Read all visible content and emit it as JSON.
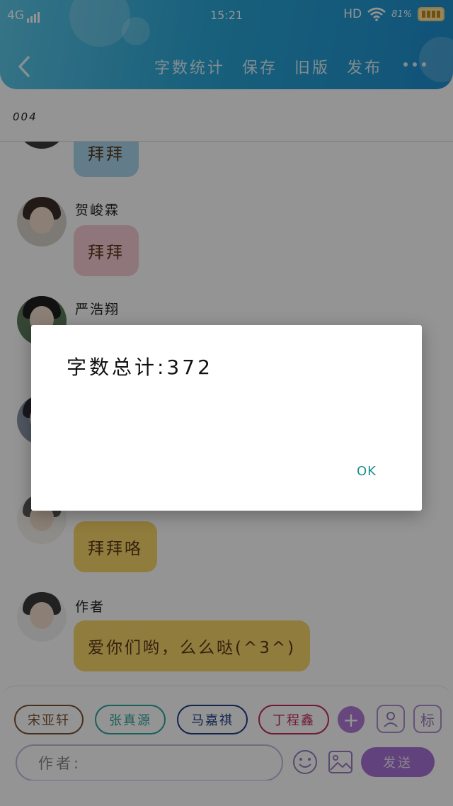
{
  "status_bar": {
    "network": "4G",
    "time": "15:21",
    "hd": "HD",
    "battery_pct": "81%"
  },
  "header": {
    "actions": [
      {
        "id": "word-count",
        "label": "字数统计"
      },
      {
        "id": "save",
        "label": "保存"
      },
      {
        "id": "old-version",
        "label": "旧版"
      },
      {
        "id": "publish",
        "label": "发布"
      }
    ]
  },
  "story": {
    "title": "004"
  },
  "messages": [
    {
      "name": "",
      "text": "拜拜",
      "color": "#a9d6ee"
    },
    {
      "name": "贺峻霖",
      "text": "拜拜",
      "color": "#f6cbd4"
    },
    {
      "name": "严浩翔",
      "text": "",
      "color": "#ffffff"
    },
    {
      "name": "",
      "text": "",
      "color": "#ffffff"
    },
    {
      "name": "",
      "text": "拜拜咯",
      "color": "#f8d668"
    },
    {
      "name": "作者",
      "text": "爱你们哟，么么哒(^3^)",
      "color": "#f8d668"
    }
  ],
  "characters": [
    {
      "label": "宋亚轩",
      "color": "#7a5232"
    },
    {
      "label": "张真源",
      "color": "#2aa59a"
    },
    {
      "label": "马嘉祺",
      "color": "#1f3d8a"
    },
    {
      "label": "丁程鑫",
      "color": "#c22c5a"
    }
  ],
  "composer": {
    "placeholder": "作者:",
    "send_label": "发送",
    "tag_label": "标"
  },
  "dialog": {
    "message": "字数总计:372",
    "ok_label": "OK"
  }
}
